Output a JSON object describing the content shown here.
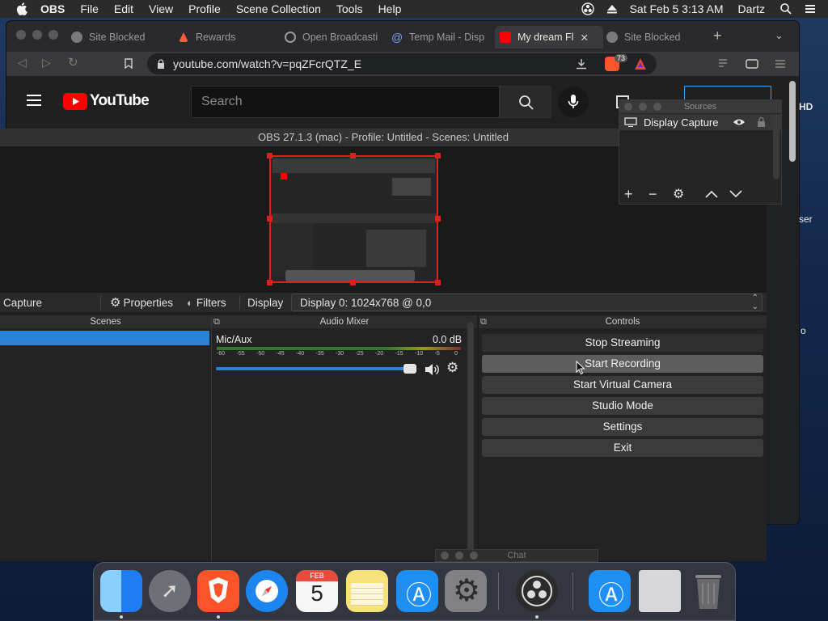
{
  "menubar": {
    "app_name": "OBS",
    "items": [
      "File",
      "Edit",
      "View",
      "Profile",
      "Scene Collection",
      "Tools",
      "Help"
    ],
    "clock": "Sat Feb 5  3:13 AM",
    "user": "Dartz"
  },
  "browser": {
    "tabs": [
      {
        "label": "Site Blocked",
        "icon": "globe-icon",
        "active": false
      },
      {
        "label": "Rewards",
        "icon": "brave-rewards-icon",
        "active": false
      },
      {
        "label": "Open Broadcasti",
        "icon": "obs-icon",
        "active": false
      },
      {
        "label": "Temp Mail - Disp",
        "icon": "at-icon",
        "active": false
      },
      {
        "label": "My dream Fl",
        "icon": "youtube-icon",
        "active": true
      },
      {
        "label": "Site Blocked",
        "icon": "globe-icon",
        "active": false
      }
    ],
    "url": "youtube.com/watch?v=pqZFcrQTZ_E",
    "shield_count": "73",
    "youtube": {
      "logo_text": "YouTube",
      "search_placeholder": "Search",
      "right_partial_1": "HD",
      "right_partial_2": "ser",
      "right_partial_3": "o"
    }
  },
  "obs": {
    "title": "OBS 27.1.3 (mac) - Profile: Untitled - Scenes: Untitled",
    "source_bar": {
      "selected_source": "Capture",
      "properties": "Properties",
      "filters": "Filters",
      "display_label": "Display",
      "display_value": "Display 0: 1024x768 @ 0,0"
    },
    "scenes_title": "Scenes",
    "mixer": {
      "title": "Audio Mixer",
      "channel": "Mic/Aux",
      "level": "0.0 dB",
      "ticks": [
        "-60",
        "-55",
        "-50",
        "-45",
        "-40",
        "-35",
        "-30",
        "-25",
        "-20",
        "-15",
        "-10",
        "-5",
        "0"
      ],
      "volume": 1.0
    },
    "controls": {
      "title": "Controls",
      "buttons": [
        "Stop Streaming",
        "Start Recording",
        "Start Virtual Camera",
        "Studio Mode",
        "Settings",
        "Exit"
      ]
    },
    "sources": {
      "title": "Sources",
      "items": [
        {
          "name": "Display Capture"
        }
      ]
    },
    "chat_title": "Chat"
  },
  "dock": {
    "apps": [
      "Finder",
      "Launchpad",
      "Brave Browser",
      "Safari",
      "Calendar",
      "Notes",
      "App Store",
      "System Preferences",
      "OBS",
      "App Store Downloads",
      "Documents",
      "Trash"
    ],
    "calendar_month": "FEB",
    "calendar_day": "5"
  },
  "colors": {
    "selection_red": "#e01e1e",
    "scene_selected": "#2a82da",
    "youtube_red": "#ff0000",
    "volume_blue": "#2a82da"
  }
}
